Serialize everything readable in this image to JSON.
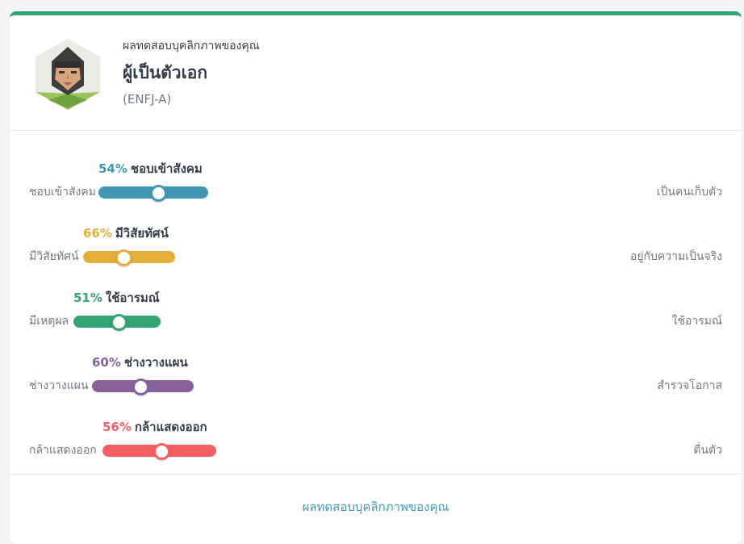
{
  "header": {
    "subtitle": "ผลทดสอบบุคลิกภาพของคุณ",
    "type_name": "ผู้เป็นตัวเอก",
    "type_code": "(ENFJ-A)"
  },
  "traits": [
    {
      "percent": "54%",
      "name": "ชอบเข้าสังคม",
      "left": "ชอบเข้าสังคม",
      "right": "เป็นคนเก็บตัว",
      "color": "#4298b4",
      "level": 0.54
    },
    {
      "percent": "66%",
      "name": "มีวิสัยทัศน์",
      "left": "มีวิสัยทัศน์",
      "right": "อยู่กับความเป็นจริง",
      "color": "#e4ae3a",
      "level": 0.66
    },
    {
      "percent": "51%",
      "name": "ใช้อารมณ์",
      "left": "มีเหตุผล",
      "right": "ใช้อารมณ์",
      "color": "#33a474",
      "level": 0.51
    },
    {
      "percent": "60%",
      "name": "ช่างวางแผน",
      "left": "ช่างวางแผน",
      "right": "สำรวจโอกาส",
      "color": "#88619a",
      "level": 0.6
    },
    {
      "percent": "56%",
      "name": "กล้าแสดงออก",
      "left": "กล้าแสดงออก",
      "right": "ตื่นตัว",
      "color": "#f25e62",
      "level": 0.56
    }
  ],
  "footer": {
    "link": "ผลทดสอบบุคลิกภาพของคุณ"
  },
  "colors": {
    "accent_top": "#33a474",
    "link": "#4298b4"
  },
  "icons": {
    "avatar": "protagonist-avatar-icon"
  }
}
